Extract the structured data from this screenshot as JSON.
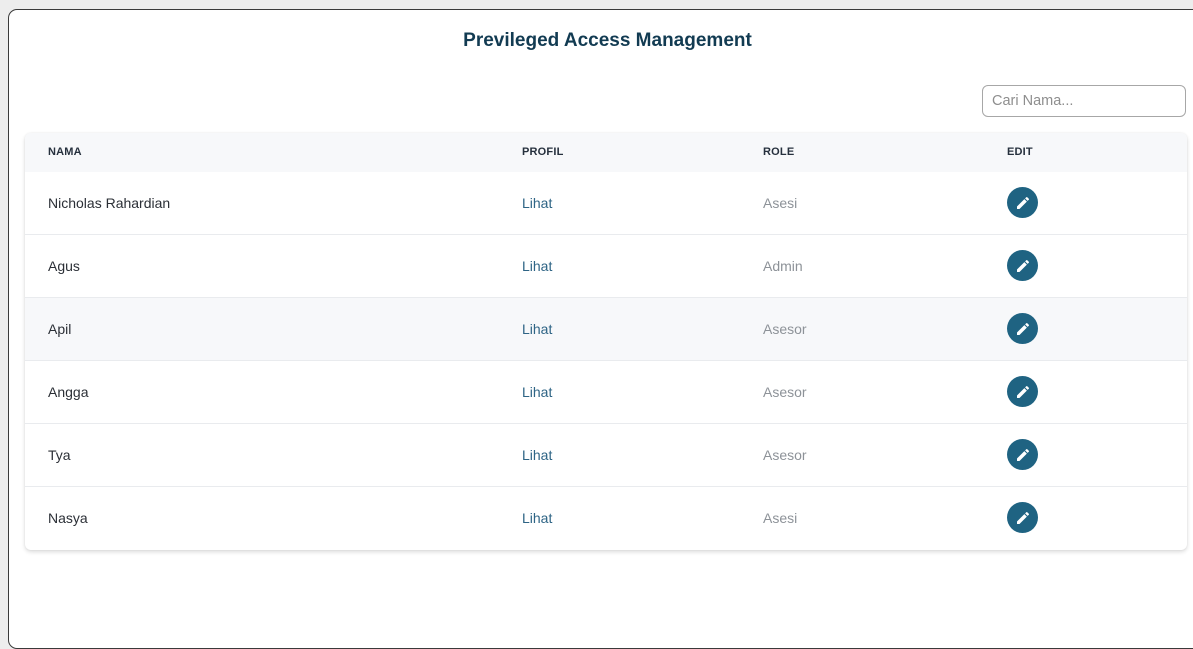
{
  "page": {
    "title": "Previleged Access Management"
  },
  "search": {
    "placeholder": "Cari Nama...",
    "value": ""
  },
  "table": {
    "headers": {
      "nama": "NAMA",
      "profil": "PROFIL",
      "role": "ROLE",
      "edit": "EDIT"
    },
    "rows": [
      {
        "nama": "Nicholas Rahardian",
        "profil": "Lihat",
        "role": "Asesi",
        "edit_icon": "pencil-icon"
      },
      {
        "nama": "Agus",
        "profil": "Lihat",
        "role": "Admin",
        "edit_icon": "pencil-icon"
      },
      {
        "nama": "Apil",
        "profil": "Lihat",
        "role": "Asesor",
        "edit_icon": "pencil-icon"
      },
      {
        "nama": "Angga",
        "profil": "Lihat",
        "role": "Asesor",
        "edit_icon": "pencil-icon"
      },
      {
        "nama": "Tya",
        "profil": "Lihat",
        "role": "Asesor",
        "edit_icon": "pencil-icon"
      },
      {
        "nama": "Nasya",
        "profil": "Lihat",
        "role": "Asesi",
        "edit_icon": "pencil-icon"
      }
    ]
  },
  "colors": {
    "title": "#123b52",
    "link": "#2e6485",
    "edit_button": "#1f6382",
    "header_bg": "#f7f8fa",
    "role_text": "#8d9298"
  }
}
